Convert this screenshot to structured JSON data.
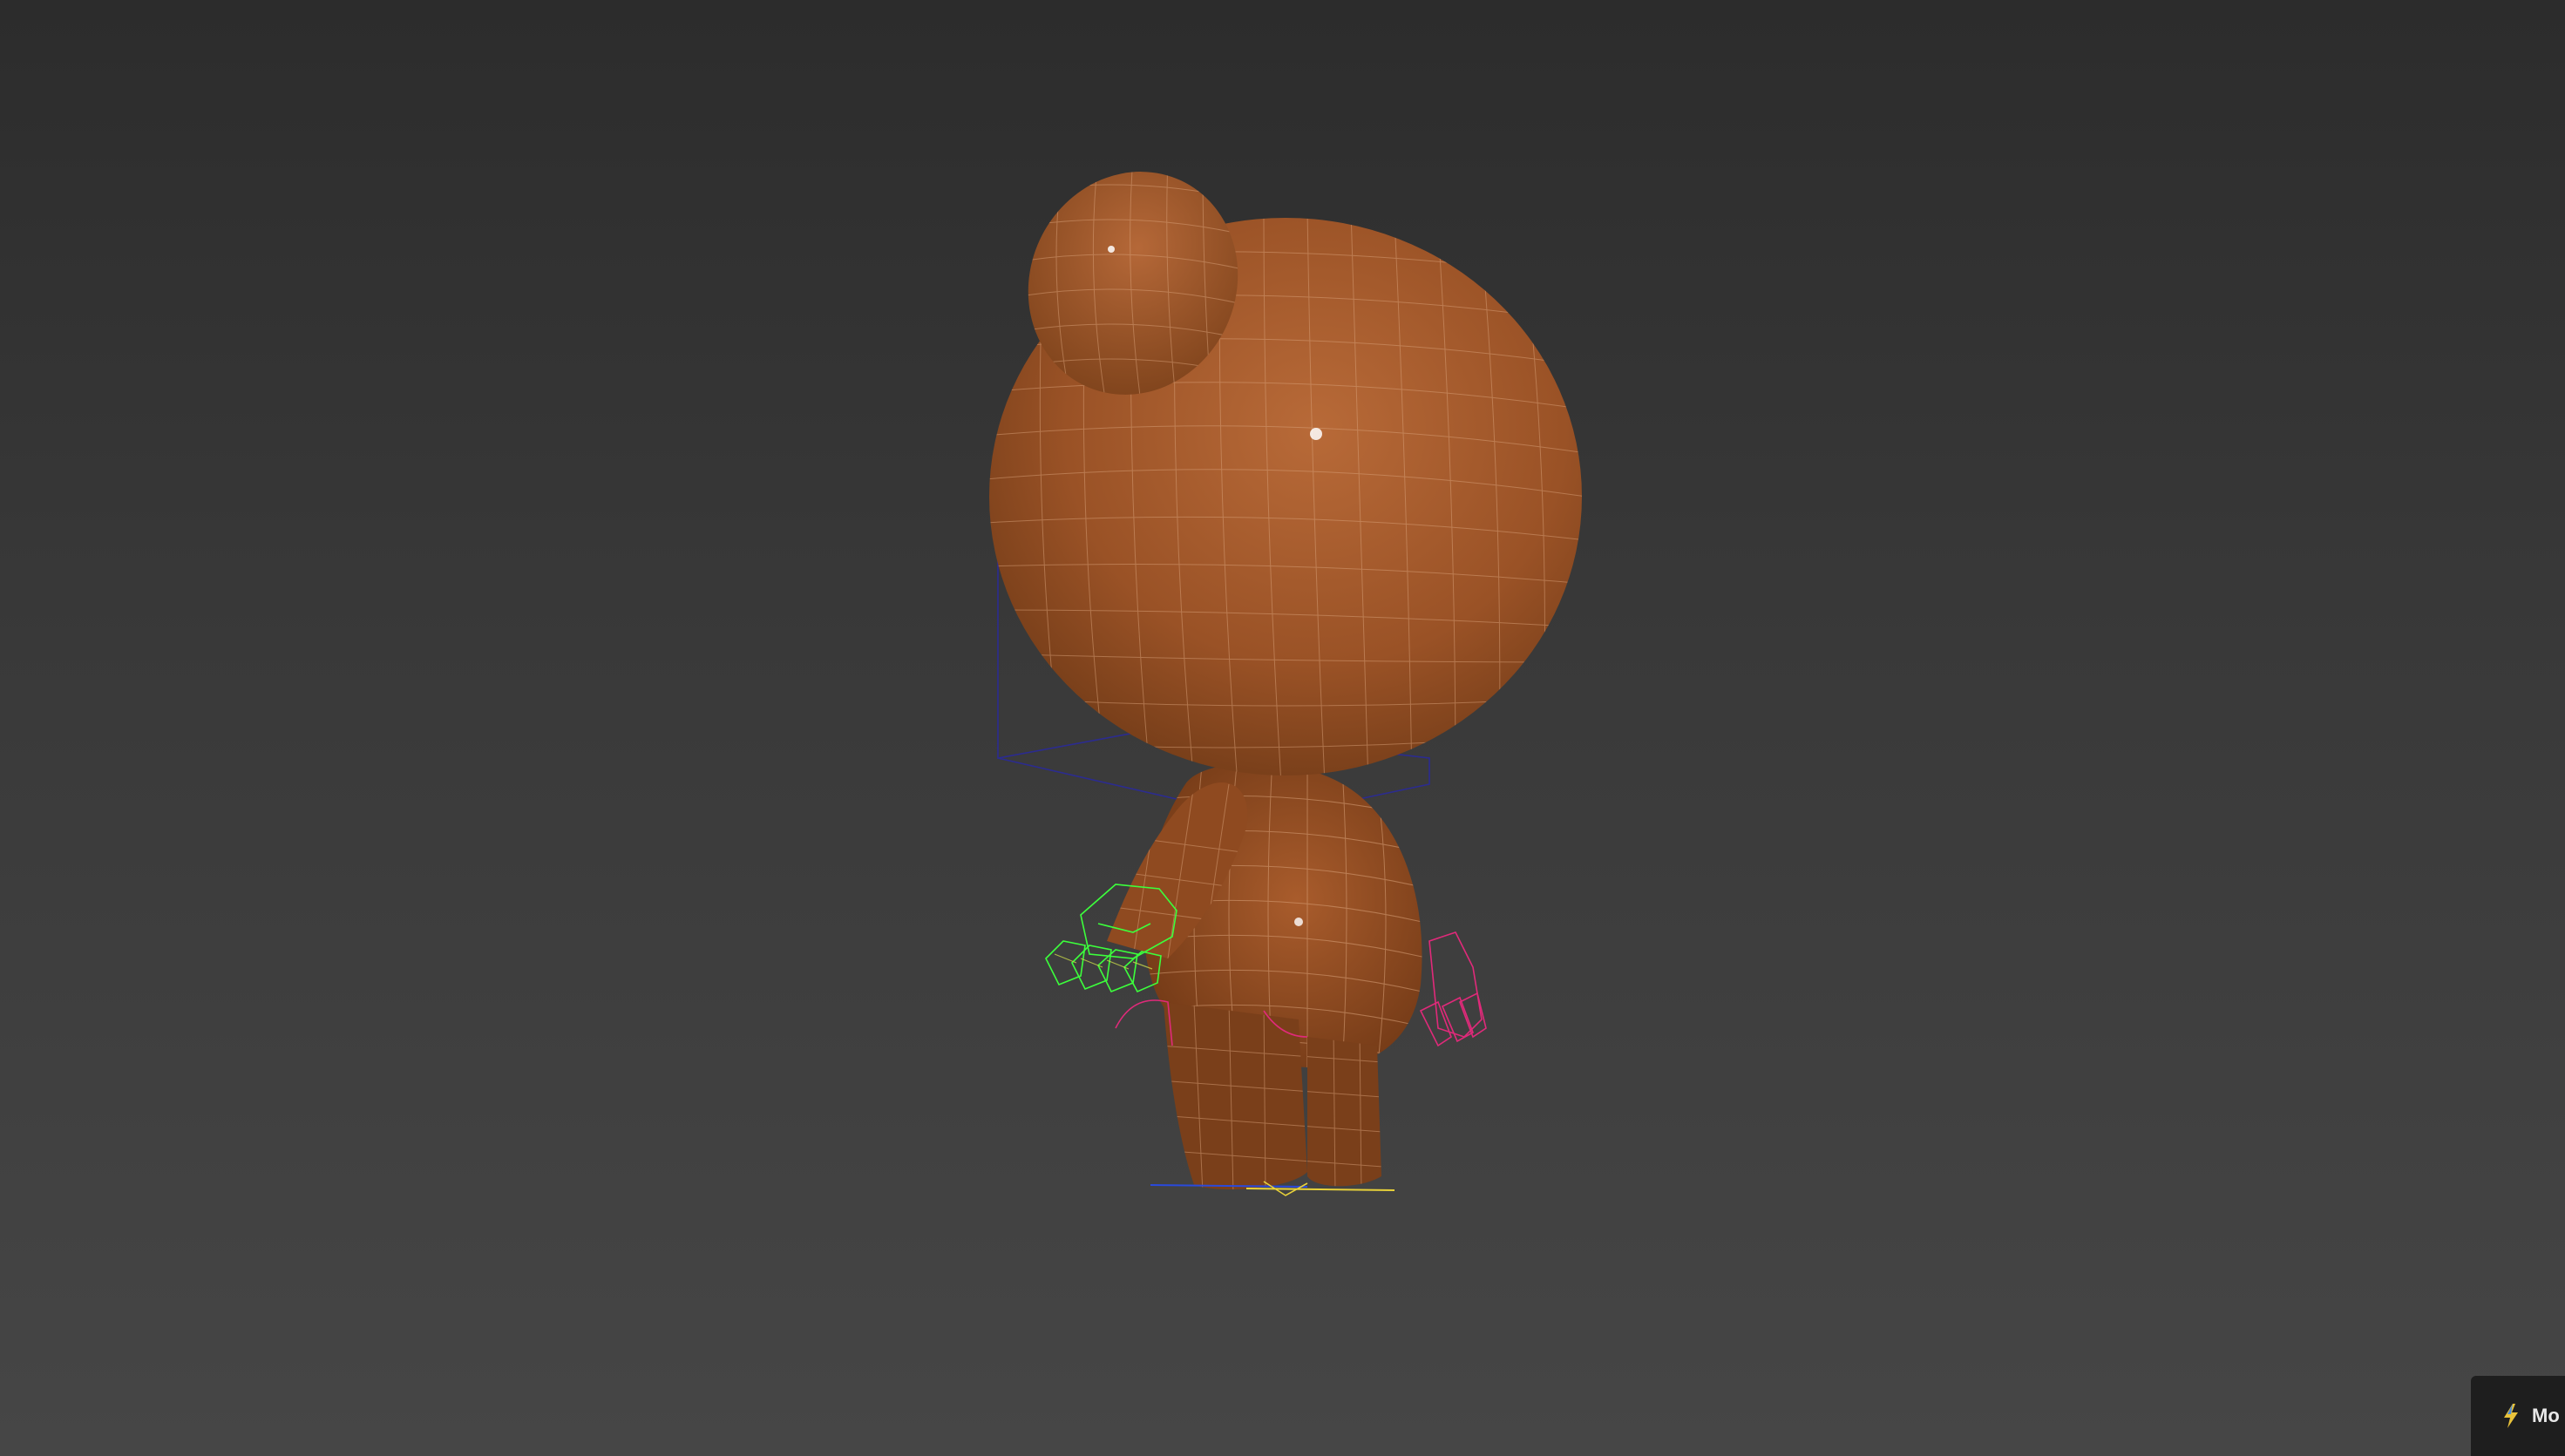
{
  "viewport": {
    "name": "perspective-viewport",
    "background_top": "#2c2c2c",
    "background_bottom": "#464646"
  },
  "model": {
    "body_color": "#a85a2e",
    "wire_color": "#d9a27a",
    "left_hand_wire_color": "#3cff3c",
    "right_hand_wire_color": "#e02a7a",
    "bounding_box_color": "#2a2a9a",
    "ground_gizmo_color": "#e8d23a"
  },
  "status_badge": {
    "icon": "lightning-icon",
    "label": "Mo"
  }
}
